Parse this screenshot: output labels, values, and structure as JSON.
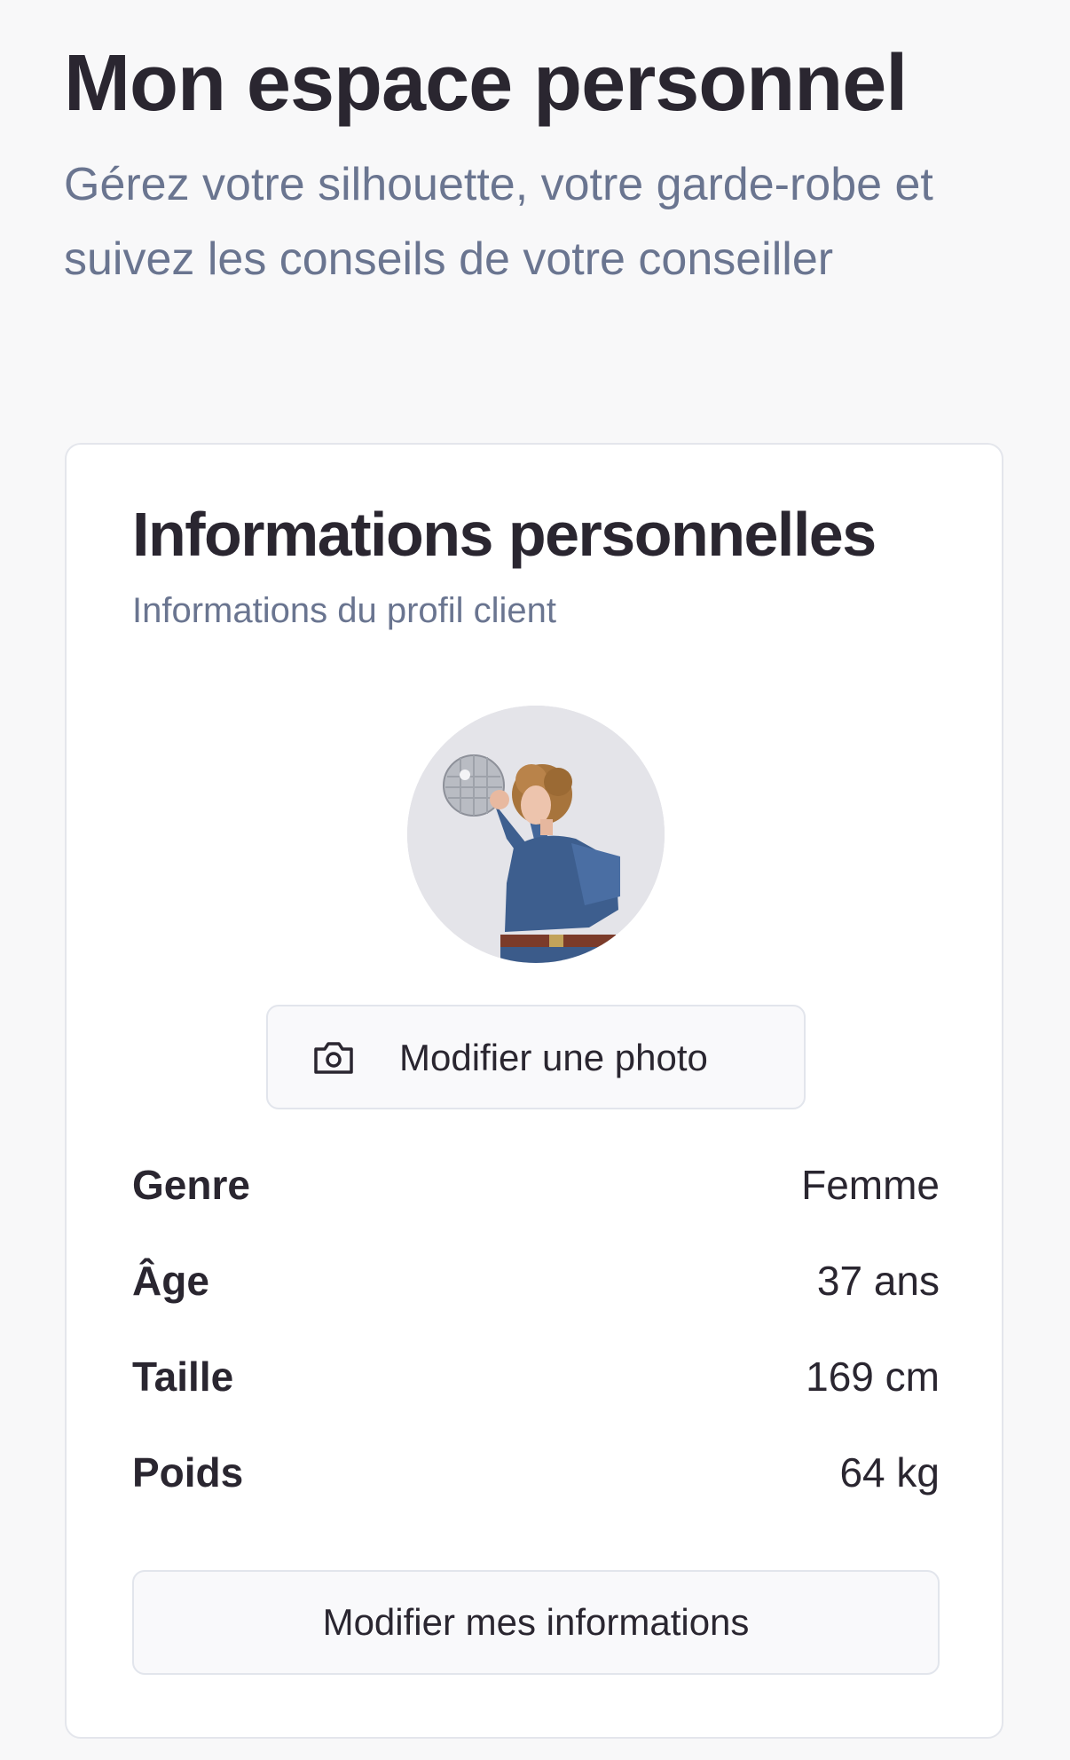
{
  "header": {
    "title": "Mon espace personnel",
    "subtitle": "Gérez votre silhouette, votre garde-robe et suivez les conseils de votre conseiller"
  },
  "card": {
    "title": "Informations personnelles",
    "subtitle": "Informations du profil client",
    "photo_button_label": "Modifier une photo",
    "photo_button_icon": "camera-icon",
    "fields": [
      {
        "label": "Genre",
        "value": "Femme"
      },
      {
        "label": "Âge",
        "value": "37 ans"
      },
      {
        "label": "Taille",
        "value": "169 cm"
      },
      {
        "label": "Poids",
        "value": "64 kg"
      }
    ],
    "edit_button_label": "Modifier mes informations"
  },
  "colors": {
    "background": "#f8f8f9",
    "text": "#2a2630",
    "muted": "#6a7590",
    "border": "#e2e5ec"
  }
}
